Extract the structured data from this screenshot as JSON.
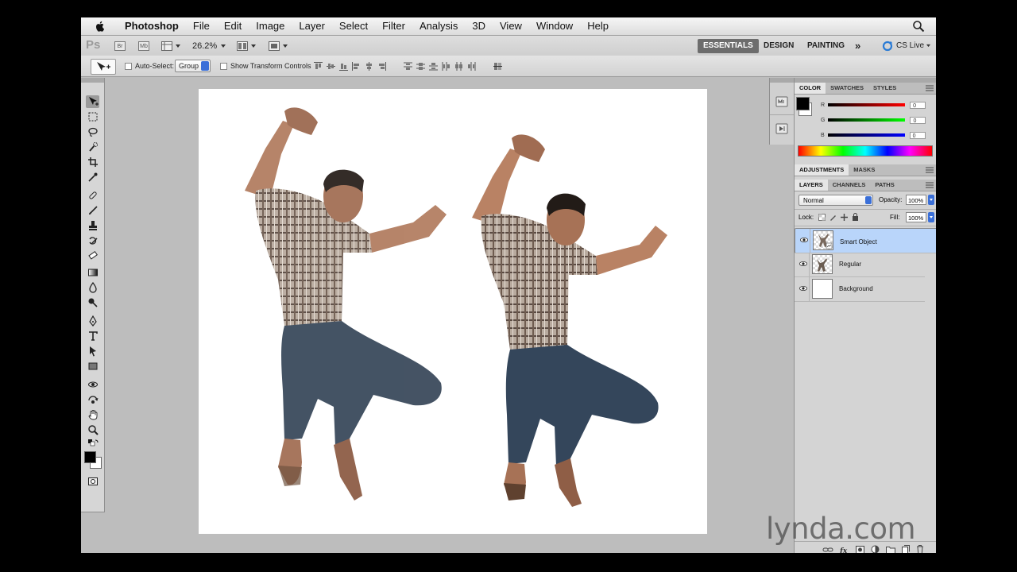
{
  "menubar": {
    "app_name": "Photoshop",
    "items": [
      "File",
      "Edit",
      "Image",
      "Layer",
      "Select",
      "Filter",
      "Analysis",
      "3D",
      "View",
      "Window",
      "Help"
    ]
  },
  "appbar": {
    "ps_logo": "Ps",
    "zoom": "26.2%",
    "bridge_label": "Br",
    "minibridge_label": "Mb",
    "workspaces": [
      "ESSENTIALS",
      "DESIGN",
      "PAINTING"
    ],
    "active_workspace": "ESSENTIALS",
    "more": "»",
    "cs_live": "CS Live"
  },
  "options": {
    "auto_select_label": "Auto-Select:",
    "auto_select_value": "Group",
    "transform_label": "Show Transform Controls"
  },
  "color_panel": {
    "tabs": [
      "COLOR",
      "SWATCHES",
      "STYLES"
    ],
    "active_tab": "COLOR",
    "channels": [
      {
        "label": "R",
        "value": "0",
        "color": "#d01010"
      },
      {
        "label": "G",
        "value": "0",
        "color": "#10a010"
      },
      {
        "label": "B",
        "value": "0",
        "color": "#1030d0"
      }
    ]
  },
  "adjustments_panel": {
    "tabs": [
      "ADJUSTMENTS",
      "MASKS"
    ],
    "active_tab": "ADJUSTMENTS"
  },
  "layers_panel": {
    "tabs": [
      "LAYERS",
      "CHANNELS",
      "PATHS"
    ],
    "active_tab": "LAYERS",
    "blend_mode": "Normal",
    "opacity_label": "Opacity:",
    "opacity": "100%",
    "lock_label": "Lock:",
    "fill_label": "Fill:",
    "fill": "100%",
    "layers": [
      {
        "name": "Smart Object",
        "selected": true
      },
      {
        "name": "Regular",
        "selected": false
      },
      {
        "name": "Background",
        "selected": false
      }
    ],
    "footer_icons": [
      "link-icon",
      "fx-icon",
      "mask-icon",
      "adjustment-icon",
      "folder-icon",
      "new-layer-icon",
      "trash-icon"
    ]
  },
  "watermark": "lynda.com",
  "colors": {
    "selection": "#b9d5fa",
    "active_workspace_bg": "#6d6d6d",
    "panel_bg": "#d4d4d4",
    "pasteboard": "#bdbdbd"
  }
}
